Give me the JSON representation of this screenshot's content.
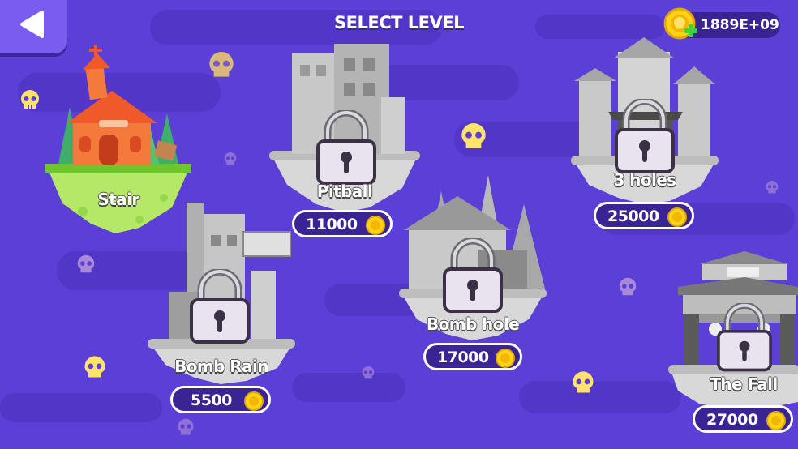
{
  "header": {
    "title": "SELECT LEVEL"
  },
  "wallet": {
    "coins": "1889E+09"
  },
  "levels": [
    {
      "name": "Stair",
      "locked": false
    },
    {
      "name": "Pitball",
      "locked": true,
      "price": "11000"
    },
    {
      "name": "3 holes",
      "locked": true,
      "price": "25000"
    },
    {
      "name": "Bomb Rain",
      "locked": true,
      "price": "5500"
    },
    {
      "name": "Bomb hole",
      "locked": true,
      "price": "17000"
    },
    {
      "name": "The Fall",
      "locked": true,
      "price": "27000"
    }
  ],
  "colors": {
    "background": "#5b3fd6",
    "panel": "#3a2392",
    "coin": "#ffd21a",
    "accent": "#7b5cf0"
  },
  "icons": [
    "back-arrow-icon",
    "coin-icon",
    "plus-icon",
    "lock-icon",
    "skull-icon"
  ]
}
